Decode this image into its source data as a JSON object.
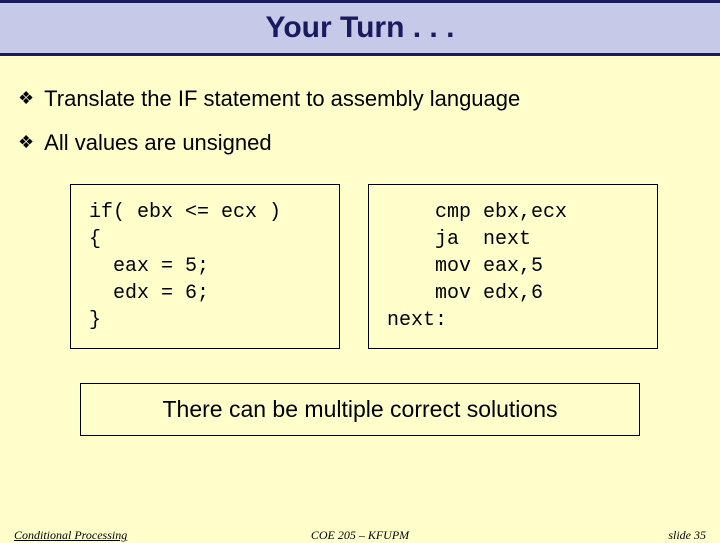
{
  "title": "Your Turn . . .",
  "bullets": [
    "Translate the IF statement to assembly language",
    "All values are unsigned"
  ],
  "code_left": "if( ebx <= ecx )\n{\n  eax = 5;\n  edx = 6;\n}",
  "code_right": "    cmp ebx,ecx\n    ja  next\n    mov eax,5\n    mov edx,6\nnext:",
  "note": "There can be multiple correct solutions",
  "footer": {
    "left": "Conditional Processing",
    "center": "COE 205 – KFUPM",
    "right": "slide 35"
  }
}
